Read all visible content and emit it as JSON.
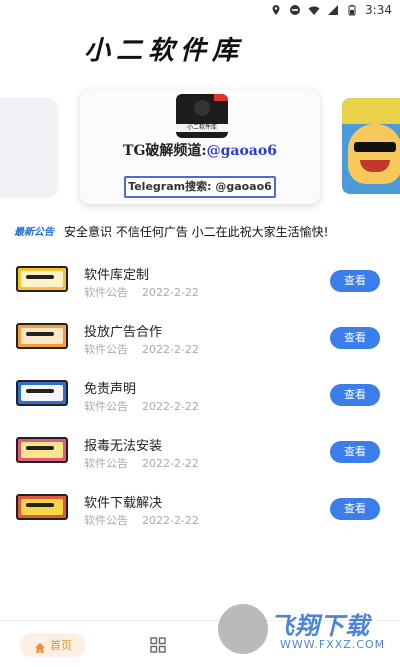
{
  "status_bar": {
    "time": "3:34",
    "icons": [
      "location-icon",
      "minus-circle-icon",
      "wifi-icon",
      "signal-icon",
      "battery-icon"
    ]
  },
  "app": {
    "title": "小二软件库"
  },
  "banner": {
    "main": {
      "avatar_text": "小二软件库",
      "line1_prefix": "TG破解频道:",
      "line1_handle": "@gaoao6",
      "box_text": "Telegram搜索: @gaoao6"
    }
  },
  "notice": {
    "badge": "最新公告",
    "text": "安全意识 不信任何广告 小二在此祝大家生活愉快!"
  },
  "list": {
    "items": [
      {
        "title": "软件库定制",
        "category": "软件公告",
        "date": "2022-2-22",
        "button": "查看",
        "thumb_color": "#f4c331",
        "thumb_inner": "#fff4c8"
      },
      {
        "title": "投放广告合作",
        "category": "软件公告",
        "date": "2022-2-22",
        "button": "查看",
        "thumb_color": "#f3a23a",
        "thumb_inner": "#fde7c6"
      },
      {
        "title": "免责声明",
        "category": "软件公告",
        "date": "2022-2-22",
        "button": "查看",
        "thumb_color": "#2f6fd0",
        "thumb_inner": "#f6f6f6"
      },
      {
        "title": "报毒无法安装",
        "category": "软件公告",
        "date": "2022-2-22",
        "button": "查看",
        "thumb_color": "#e35a7a",
        "thumb_inner": "#f9e58c"
      },
      {
        "title": "软件下载解决",
        "category": "软件公告",
        "date": "2022-2-22",
        "button": "查看",
        "thumb_color": "#e05a3a",
        "thumb_inner": "#f7d64a"
      }
    ]
  },
  "bottom_nav": {
    "home_label": "首页"
  },
  "watermark": {
    "title": "飞翔下载",
    "url": "WWW.FXXZ.COM"
  },
  "colors": {
    "accent": "#3b7de9",
    "home_active": "#e3933b",
    "notice_badge": "#1f6fd6"
  }
}
